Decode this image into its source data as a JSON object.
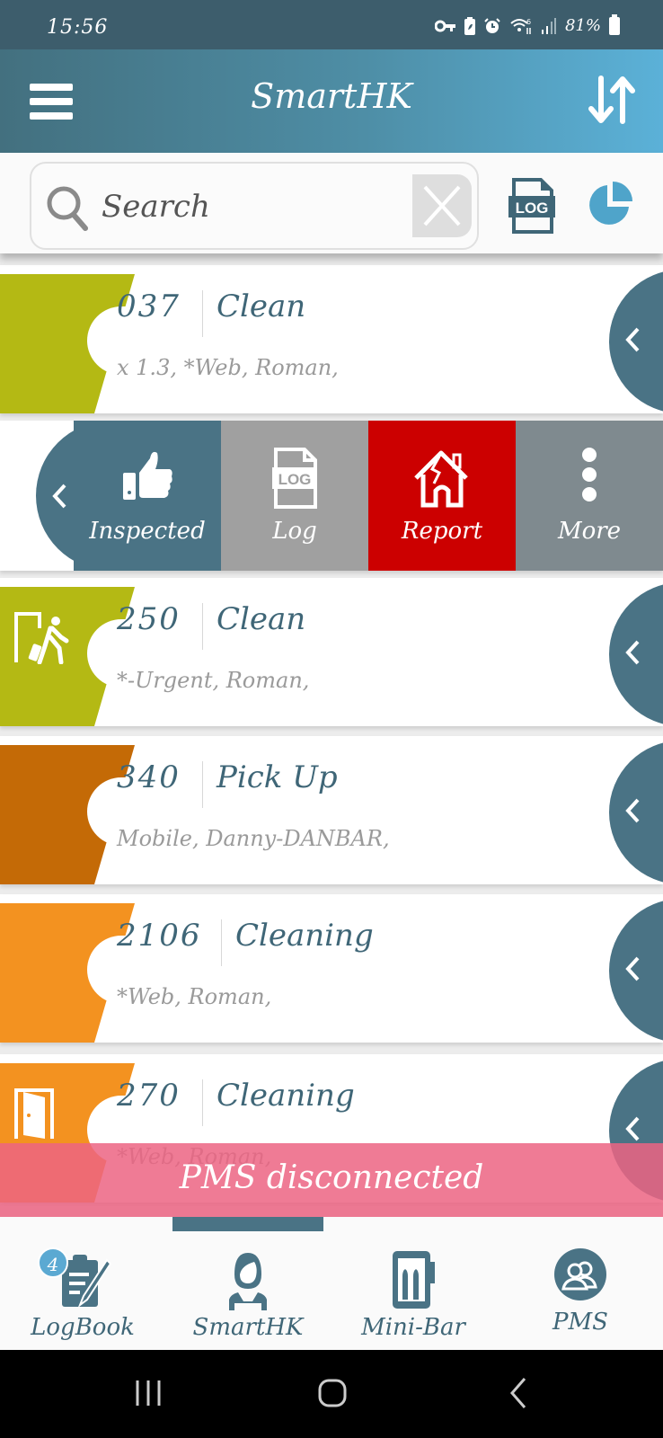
{
  "status_bar": {
    "time": "15:56",
    "battery_percent": "81%",
    "icons": [
      "vpn-key-icon",
      "battery-saver-icon",
      "alarm-icon",
      "wifi-icon",
      "signal-icon",
      "battery-icon"
    ]
  },
  "app_bar": {
    "title": "SmartHK",
    "menu_icon": "hamburger-menu-icon",
    "sort_icon": "sort-arrows-icon"
  },
  "search": {
    "placeholder": "Search",
    "value": "",
    "clear_icon": "close-icon",
    "log_button_label": "LOG",
    "stats_icon": "pie-chart-icon"
  },
  "colors": {
    "primary": "#4a7385",
    "lime": "#b4b914",
    "dark_orange": "#c46a06",
    "orange": "#f39220",
    "red_action": "#cc0000",
    "gray_log": "#a0a0a0",
    "gray_more": "#7f8a8f",
    "toast": "#ec6482"
  },
  "rooms": [
    {
      "room": "037",
      "status": "Clean",
      "details": "x 1.3, *Web, Roman,",
      "band_color": "#b4b914",
      "band_icon": ""
    },
    {
      "room": "250",
      "status": "Clean",
      "details": "*-Urgent, Roman,",
      "band_color": "#b4b914",
      "band_icon": "guest-departure-icon"
    },
    {
      "room": "340",
      "status": "Pick Up",
      "details": "Mobile, Danny-DANBAR,",
      "band_color": "#c46a06",
      "band_icon": ""
    },
    {
      "room": "2106",
      "status": "Cleaning",
      "details": "*Web, Roman,",
      "band_color": "#f39220",
      "band_icon": ""
    },
    {
      "room": "270",
      "status": "Cleaning",
      "details": "*Web, Roman,",
      "band_color": "#f39220",
      "band_icon": "open-door-icon"
    }
  ],
  "swipe_actions": [
    {
      "label": "Inspected",
      "icon": "thumbs-up-icon",
      "color": "#4a7385"
    },
    {
      "label": "Log",
      "icon": "log-file-icon",
      "color": "#a0a0a0"
    },
    {
      "label": "Report",
      "icon": "broken-house-icon",
      "color": "#cc0000"
    },
    {
      "label": "More",
      "icon": "more-vertical-icon",
      "color": "#7f8a8f"
    }
  ],
  "toast": {
    "message": "PMS disconnected"
  },
  "bottom_nav": {
    "active": "SmartHK",
    "items": [
      {
        "label": "LogBook",
        "icon": "logbook-icon",
        "badge": "4"
      },
      {
        "label": "SmartHK",
        "icon": "housekeeper-icon"
      },
      {
        "label": "Mini-Bar",
        "icon": "minibar-fridge-icon"
      },
      {
        "label": "PMS",
        "icon": "pms-users-icon"
      }
    ]
  },
  "system_nav": [
    "recent-apps-icon",
    "home-icon",
    "back-icon"
  ]
}
